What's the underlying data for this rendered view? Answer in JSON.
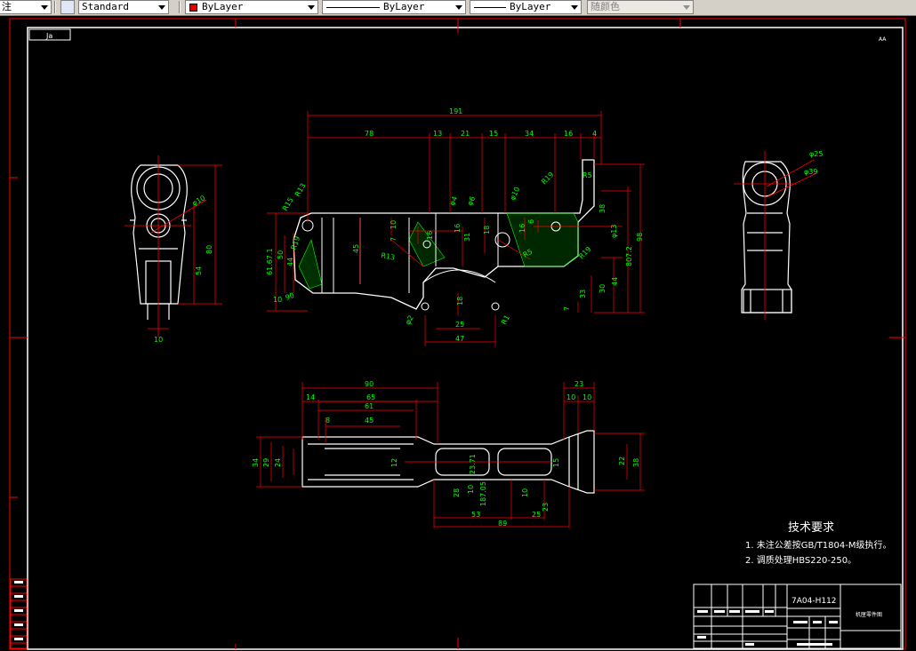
{
  "toolbar": {
    "annot_style": "注",
    "text_style": "Standard",
    "layer_color": "ByLayer",
    "linetype": "ByLayer",
    "lineweight": "ByLayer",
    "plot_style": "随颜色"
  },
  "drawing": {
    "corner_mark": "Ja",
    "top_right_mark": "AA",
    "tech_req": {
      "title": "技术要求",
      "items": [
        "1. 未注公差按GB/T1804-M级执行。",
        "2. 调质处理HBS220-250。"
      ]
    },
    "title_block": {
      "drawing_no": "7A04-H112",
      "title": "机匣零件图"
    },
    "dims_front": [
      "191",
      "78",
      "13",
      "21",
      "15",
      "34",
      "16",
      "4",
      "R19",
      "R5",
      "φ4",
      "φ6",
      "φ10",
      "R15",
      "R13",
      "R13",
      "R5",
      "45",
      "10",
      "7",
      "16",
      "31",
      "18",
      "16",
      "6",
      "φ13",
      "16",
      "50",
      "61.67.1",
      "44",
      "10",
      "R19",
      "90",
      "807.2",
      "98",
      "38",
      "30",
      "44",
      "33",
      "7",
      "φ2",
      "18",
      "25",
      "47",
      "R1",
      "R19"
    ],
    "dims_left": [
      "80",
      "54",
      "φ10",
      "10"
    ],
    "dims_right": [
      "φ25",
      "φ39"
    ],
    "dims_bottom": [
      "90",
      "14",
      "65",
      "61",
      "8",
      "45",
      "23",
      "10",
      "10",
      "34",
      "29",
      "24",
      "12",
      "23.71",
      "15",
      "22",
      "38",
      "28",
      "10",
      "187.05",
      "10",
      "23",
      "53",
      "25",
      "89"
    ]
  }
}
